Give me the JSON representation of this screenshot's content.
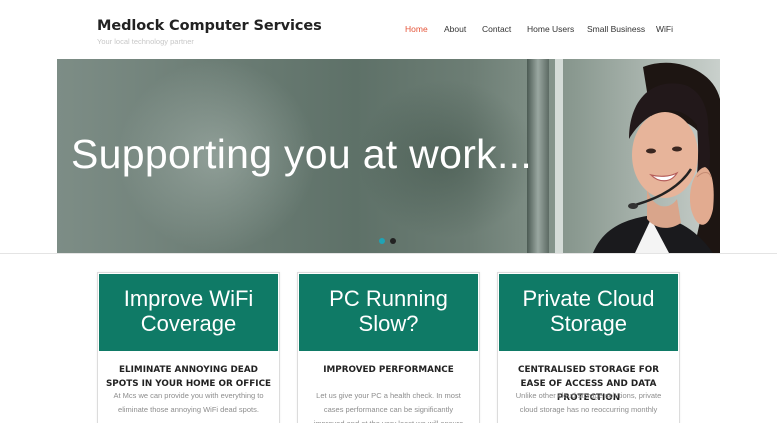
{
  "site": {
    "title": "Medlock Computer Services",
    "tagline": "Your local technology partner"
  },
  "nav": {
    "items": [
      {
        "label": "Home",
        "active": true
      },
      {
        "label": "About",
        "active": false
      },
      {
        "label": "Contact",
        "active": false
      },
      {
        "label": "Home Users",
        "active": false
      },
      {
        "label": "Small Business",
        "active": false
      },
      {
        "label": "WiFi",
        "active": false
      }
    ],
    "active_color": "#e5553a"
  },
  "slider": {
    "caption": "Supporting you at work...",
    "slide_count": 2,
    "current_slide": 1,
    "dot_active_color": "#1fa3b5"
  },
  "cards": [
    {
      "image_text": "Improve WiFi\nCoverage",
      "title": "ELIMINATE ANNOYING DEAD SPOTS IN YOUR HOME OR OFFICE",
      "body": "At Mcs we can provide you with everything to eliminate those annoying WiFi dead spots."
    },
    {
      "image_text": "PC Running\nSlow?",
      "title": "IMPROVED PERFORMANCE",
      "body": "Let us give your PC a health check. In most cases performance can be significantly improved and at the very least we will ensure"
    },
    {
      "image_text": "Private Cloud\nStorage",
      "title": "CENTRALISED STORAGE FOR EASE OF ACCESS AND DATA PROTECTION",
      "body": "Unlike other cloud storage solutions, private cloud storage has no reoccurring monthly"
    }
  ],
  "colors": {
    "card_accent": "#0f7a66",
    "site_title": "#222222"
  }
}
